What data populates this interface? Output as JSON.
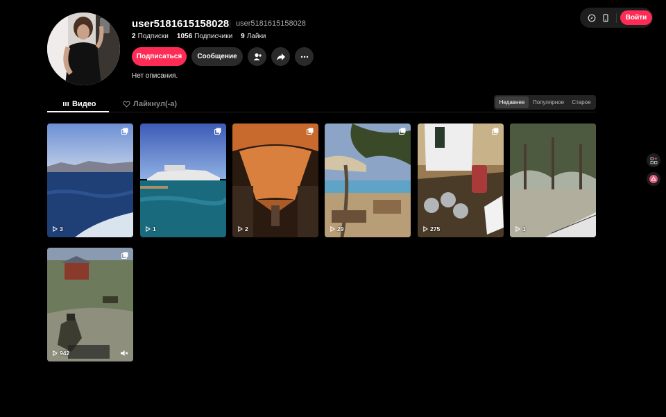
{
  "topbar": {
    "login_label": "Войти",
    "icons": [
      "compass-icon",
      "phone-icon"
    ]
  },
  "profile": {
    "username": "user5181615158028",
    "nickname": "user5181615158028",
    "following_count": "2",
    "following_label": "Подписки",
    "followers_count": "1056",
    "followers_label": "Подписчики",
    "likes_count": "9",
    "likes_label": "Лайки",
    "follow_label": "Подписаться",
    "message_label": "Сообщение",
    "bio": "Нет описания."
  },
  "tabs": {
    "videos_label": "Видео",
    "liked_label": "Лайкнул(-а)"
  },
  "sort": {
    "options": [
      "Недавнее",
      "Популярное",
      "Старое"
    ],
    "active": "Недавнее"
  },
  "videos": [
    {
      "views": "3",
      "scene": "sea",
      "multi": true
    },
    {
      "views": "1",
      "scene": "yacht",
      "multi": true
    },
    {
      "views": "2",
      "scene": "cabin",
      "multi": true
    },
    {
      "views": "29",
      "scene": "beach",
      "multi": true
    },
    {
      "views": "275",
      "scene": "drinks",
      "multi": true
    },
    {
      "views": "1",
      "scene": "forest",
      "multi": false
    },
    {
      "views": "942",
      "scene": "game",
      "multi": true,
      "muted": true
    }
  ]
}
